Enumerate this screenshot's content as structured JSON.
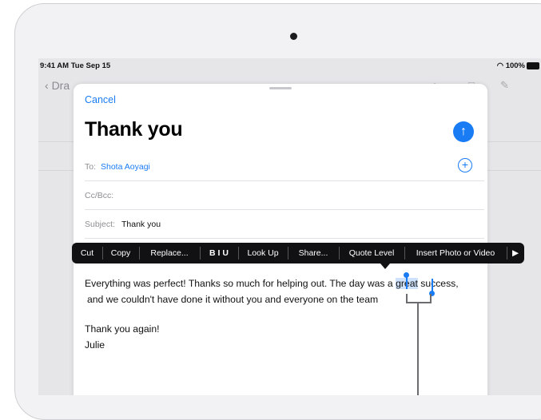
{
  "status_bar": {
    "time": "9:41 AM  Tue Sep 15",
    "right": "100%"
  },
  "background_nav": {
    "back_label": "Dra"
  },
  "compose": {
    "cancel_label": "Cancel",
    "title": "Thank you",
    "to_label": "To:",
    "to_value": "Shota Aoyagi",
    "cc_label": "Cc/Bcc:",
    "subject_label": "Subject:",
    "subject_value": "Thank you",
    "body_line1_pre": "Everything was perfect! Thanks so much for helping out. The day was a ",
    "body_selected": "great",
    "body_line1_post": " success,",
    "body_line2": "and we couldn't have done it without you and everyone on the team",
    "body_line3": "Thank you again!",
    "body_line4": "Julie"
  },
  "edit_menu": {
    "items": [
      "Cut",
      "Copy",
      "Replace...",
      "B I U",
      "Look Up",
      "Share...",
      "Quote Level",
      "Insert Photo or Video",
      "▶"
    ]
  },
  "colors": {
    "accent": "#1a7cf5",
    "menu_bg": "#111114",
    "selection": "#cfe2fb"
  }
}
